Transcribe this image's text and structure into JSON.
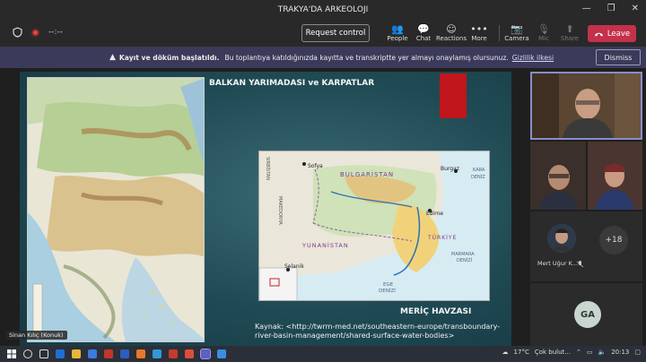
{
  "window": {
    "title": "TRAKYA'DA ARKEOLOJI",
    "controls": [
      "—",
      "❐",
      "✕"
    ]
  },
  "toolbar": {
    "timer": "--:--",
    "request_control": "Request control",
    "items": [
      {
        "label": "People",
        "icon": "people-icon",
        "glyph": "👥"
      },
      {
        "label": "Chat",
        "icon": "chat-icon",
        "glyph": "💬"
      },
      {
        "label": "Reactions",
        "icon": "reactions-icon",
        "glyph": "☺"
      },
      {
        "label": "More",
        "icon": "more-icon",
        "glyph": "•••"
      },
      {
        "label": "Camera",
        "icon": "camera-icon",
        "glyph": "📷"
      },
      {
        "label": "Mic",
        "icon": "mic-icon",
        "glyph": "🎙"
      },
      {
        "label": "Share",
        "icon": "share-icon",
        "glyph": "⬆"
      }
    ],
    "leave": "Leave"
  },
  "banner": {
    "bold": "Kayıt ve döküm başlatıldı.",
    "text": "Bu toplantıya katıldığınızda kayıtta ve transkriptte yer almayı onaylamış olursunuz.",
    "link": "Gizlilik ilkesi",
    "dismiss": "Dismiss"
  },
  "slide": {
    "title": "BALKAN YARIMADASI ve KARPATLAR",
    "subtitle": "MERİÇ HAVZASI",
    "source": "Kaynak: <http://twrm-med.net/southeastern-europe/transboundary-river-basin-management/shared-surface-water-bodies>",
    "map_labels": {
      "bulgaristan": "BULGARİSTAN",
      "sofya": "Sofya",
      "burgaz": "Burgaz",
      "kara": "KARA",
      "deniz": "DENİZ",
      "sirbistan": "SIRBİSTAN",
      "makedonya": "MAKEDONYA",
      "edirne": "Edirne",
      "turkiye": "TÜRKİYE",
      "yunanistan": "YUNANİSTAN",
      "marmara": "MARMARA",
      "marmara_deniz": "DENİZİ",
      "selanik": "Selanik",
      "ege": "EGE",
      "ege_deniz": "DENİZİ"
    }
  },
  "presenter_tag": "Sinan Kılıç (Konuk)",
  "participants": {
    "mert": "Mert Uğur K...",
    "overflow": "+18",
    "ga": "GA"
  },
  "taskbar": {
    "temp": "17°C",
    "weather": "Çok bulut...",
    "time": "20:13"
  }
}
